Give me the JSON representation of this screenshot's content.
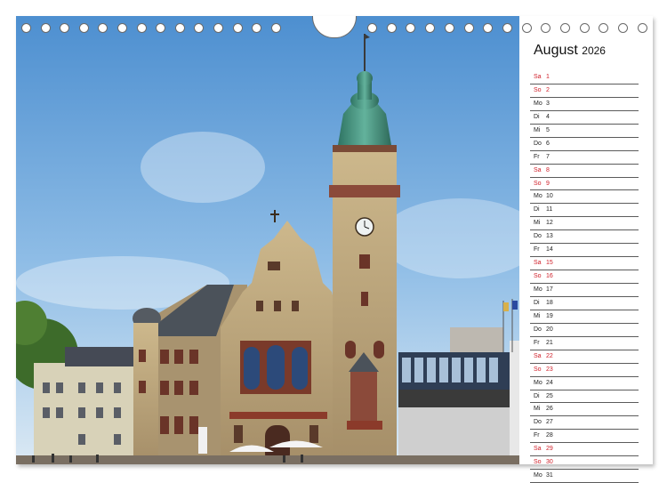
{
  "calendar": {
    "month": "August",
    "year": "2026",
    "days": [
      {
        "wd": "Sa",
        "n": "1",
        "weekend": true
      },
      {
        "wd": "So",
        "n": "2",
        "weekend": true
      },
      {
        "wd": "Mo",
        "n": "3",
        "weekend": false
      },
      {
        "wd": "Di",
        "n": "4",
        "weekend": false
      },
      {
        "wd": "Mi",
        "n": "5",
        "weekend": false
      },
      {
        "wd": "Do",
        "n": "6",
        "weekend": false
      },
      {
        "wd": "Fr",
        "n": "7",
        "weekend": false
      },
      {
        "wd": "Sa",
        "n": "8",
        "weekend": true
      },
      {
        "wd": "So",
        "n": "9",
        "weekend": true
      },
      {
        "wd": "Mo",
        "n": "10",
        "weekend": false
      },
      {
        "wd": "Di",
        "n": "11",
        "weekend": false
      },
      {
        "wd": "Mi",
        "n": "12",
        "weekend": false
      },
      {
        "wd": "Do",
        "n": "13",
        "weekend": false
      },
      {
        "wd": "Fr",
        "n": "14",
        "weekend": false
      },
      {
        "wd": "Sa",
        "n": "15",
        "weekend": true
      },
      {
        "wd": "So",
        "n": "16",
        "weekend": true
      },
      {
        "wd": "Mo",
        "n": "17",
        "weekend": false
      },
      {
        "wd": "Di",
        "n": "18",
        "weekend": false
      },
      {
        "wd": "Mi",
        "n": "19",
        "weekend": false
      },
      {
        "wd": "Do",
        "n": "20",
        "weekend": false
      },
      {
        "wd": "Fr",
        "n": "21",
        "weekend": false
      },
      {
        "wd": "Sa",
        "n": "22",
        "weekend": true
      },
      {
        "wd": "So",
        "n": "23",
        "weekend": true
      },
      {
        "wd": "Mo",
        "n": "24",
        "weekend": false
      },
      {
        "wd": "Di",
        "n": "25",
        "weekend": false
      },
      {
        "wd": "Mi",
        "n": "26",
        "weekend": false
      },
      {
        "wd": "Do",
        "n": "27",
        "weekend": false
      },
      {
        "wd": "Fr",
        "n": "28",
        "weekend": false
      },
      {
        "wd": "Sa",
        "n": "29",
        "weekend": true
      },
      {
        "wd": "So",
        "n": "30",
        "weekend": true
      },
      {
        "wd": "Mo",
        "n": "31",
        "weekend": false
      }
    ]
  },
  "colors": {
    "weekend": "#d0202a",
    "sky": "#5f9fd8",
    "stone": "#b9a27a",
    "roof": "#3f8d7a"
  }
}
